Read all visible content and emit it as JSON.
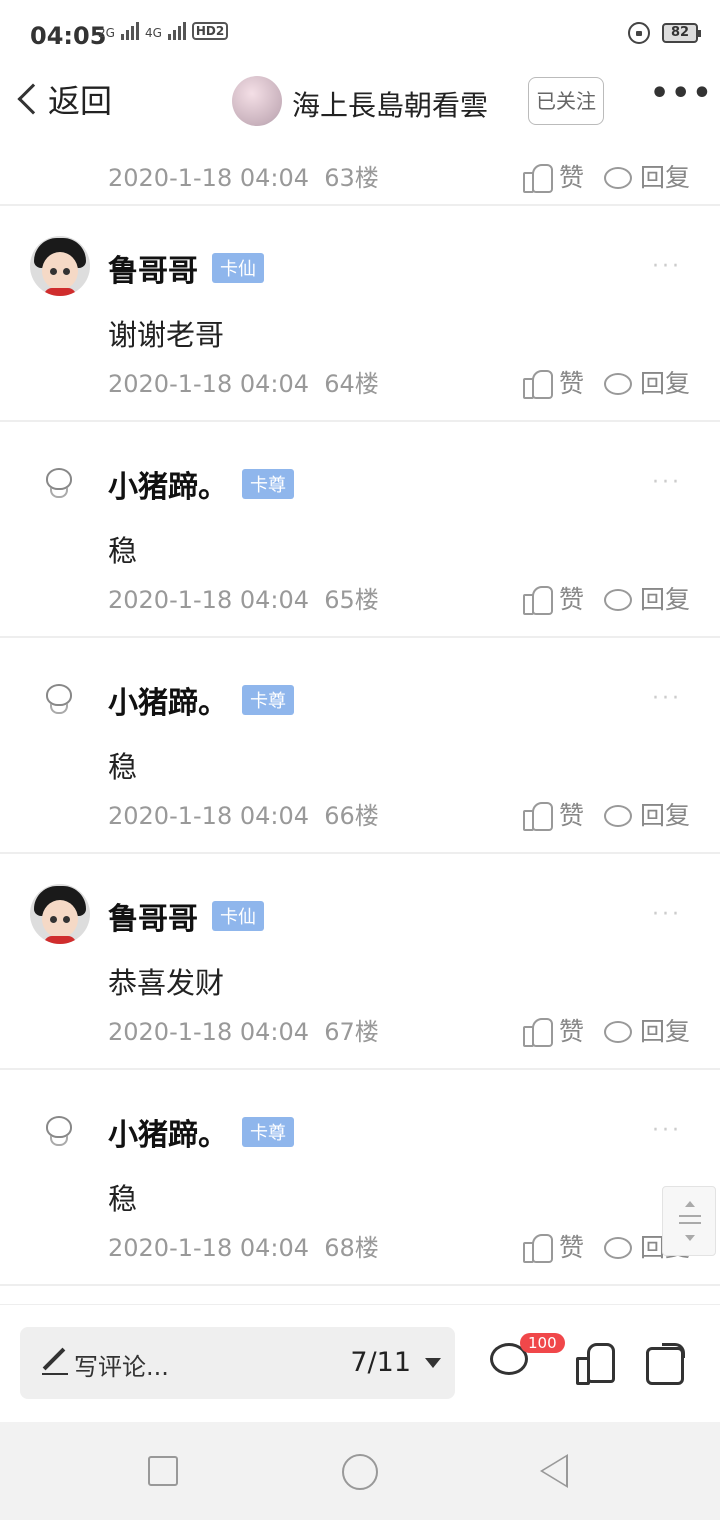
{
  "status_bar": {
    "time": "04:05",
    "net1": "2G",
    "net2": "4G",
    "hd": "HD2",
    "battery": "82"
  },
  "nav": {
    "back_label": "返回",
    "title": "海上長島朝看雲",
    "follow_label": "已关注",
    "more_label": "•••"
  },
  "actions": {
    "like_label": "赞",
    "reply_label": "回复",
    "more_label": "···"
  },
  "top_meta": {
    "timestamp": "2020-1-18 04:04",
    "floor": "63楼"
  },
  "posts": [
    {
      "username": "鲁哥哥",
      "badge": "卡仙",
      "content": "谢谢老哥",
      "timestamp": "2020-1-18 04:04",
      "floor": "64楼",
      "avatar": "boy-avatar"
    },
    {
      "username": "小猪蹄。",
      "badge": "卡尊",
      "content": "稳",
      "timestamp": "2020-1-18 04:04",
      "floor": "65楼",
      "avatar": "pig-avatar"
    },
    {
      "username": "小猪蹄。",
      "badge": "卡尊",
      "content": "稳",
      "timestamp": "2020-1-18 04:04",
      "floor": "66楼",
      "avatar": "pig-avatar"
    },
    {
      "username": "鲁哥哥",
      "badge": "卡仙",
      "content": "恭喜发财",
      "timestamp": "2020-1-18 04:04",
      "floor": "67楼",
      "avatar": "boy-avatar"
    },
    {
      "username": "小猪蹄。",
      "badge": "卡尊",
      "content": "稳",
      "timestamp": "2020-1-18 04:04",
      "floor": "68楼",
      "avatar": "pig-avatar"
    }
  ],
  "bottom_bar": {
    "comment_placeholder": "写评论...",
    "page_indicator": "7/11",
    "comment_count": "100"
  },
  "colors": {
    "badge": "#8fb6ec",
    "notification": "#f0474a"
  }
}
